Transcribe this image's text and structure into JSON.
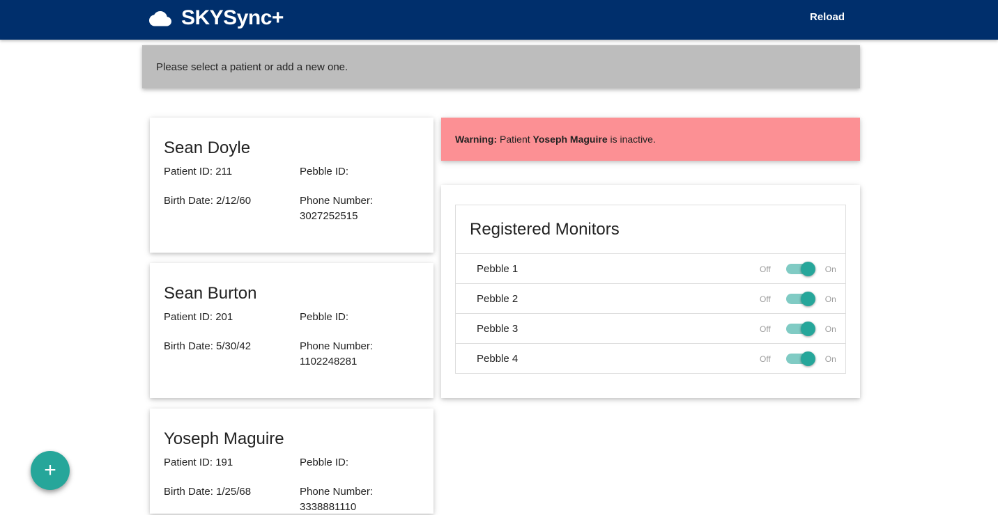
{
  "header": {
    "brand": "SKYSync+",
    "brand_icon": "cloud-icon",
    "reload_label": "Reload",
    "bg_color": "#002f6c"
  },
  "info_bar": {
    "text": "Please select a patient or add a new one."
  },
  "patients": [
    {
      "name": "Sean Doyle",
      "patient_id": "Patient ID: 211",
      "pebble_id": "Pebble ID:",
      "birth_date": "Birth Date: 2/12/60",
      "phone_label": "Phone Number:",
      "phone": "3027252515"
    },
    {
      "name": "Sean Burton",
      "patient_id": "Patient ID: 201",
      "pebble_id": "Pebble ID:",
      "birth_date": "Birth Date: 5/30/42",
      "phone_label": "Phone Number:",
      "phone": "1102248281"
    },
    {
      "name": "Yoseph Maguire",
      "patient_id": "Patient ID: 191",
      "pebble_id": "Pebble ID:",
      "birth_date": "Birth Date: 1/25/68",
      "phone_label": "Phone Number:",
      "phone": "3338881110"
    }
  ],
  "warning": {
    "prefix": "Warning:",
    "before": "Patient",
    "patient": "Yoseph Maguire",
    "after": "is inactive.",
    "bg_color": "#fc9094"
  },
  "monitors": {
    "title": "Registered Monitors",
    "off_label": "Off",
    "on_label": "On",
    "items": [
      {
        "name": "Pebble 1",
        "enabled": true
      },
      {
        "name": "Pebble 2",
        "enabled": true
      },
      {
        "name": "Pebble 3",
        "enabled": true
      },
      {
        "name": "Pebble 4",
        "enabled": true
      }
    ],
    "accent_color": "#26a69a"
  },
  "fab": {
    "label": "+",
    "icon": "plus-icon",
    "color": "#26a69a"
  }
}
